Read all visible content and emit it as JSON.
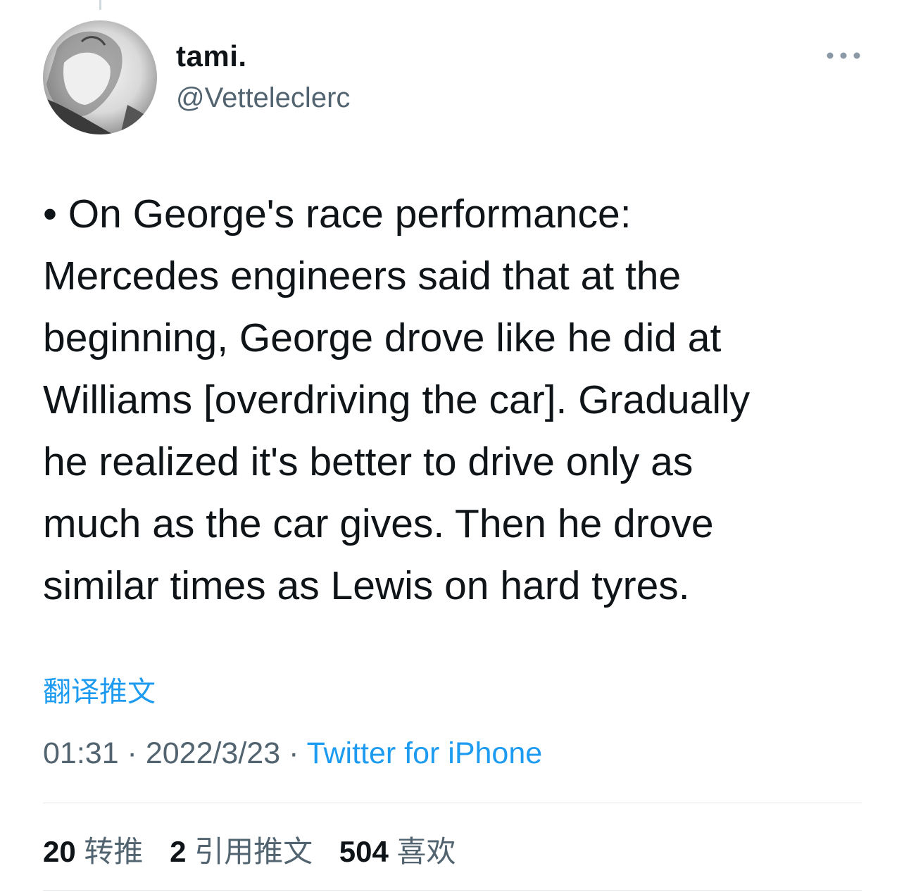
{
  "user": {
    "display_name": "tami.",
    "handle": "@Vetteleclerc"
  },
  "tweet": {
    "text": "• On George's race performance:\nMercedes engineers said that at the\nbeginning, George drove like he did at\nWilliams [overdriving the car]. Gradually\nhe realized it's better to drive only as\nmuch as the car gives. Then he drove\nsimilar times as Lewis on hard tyres.",
    "translate_label": "翻译推文",
    "time": "01:31",
    "separator": " · ",
    "date": "2022/3/23",
    "source": "Twitter for iPhone"
  },
  "stats": {
    "retweets_count": "20",
    "retweets_label": "转推",
    "quotes_count": "2",
    "quotes_label": "引用推文",
    "likes_count": "504",
    "likes_label": "喜欢"
  },
  "icons": {
    "more": "more-horizontal-icon"
  },
  "colors": {
    "link": "#1d9bf0",
    "secondary_text": "#536471",
    "primary_text": "#0f1419",
    "divider": "#e1e6ea"
  }
}
